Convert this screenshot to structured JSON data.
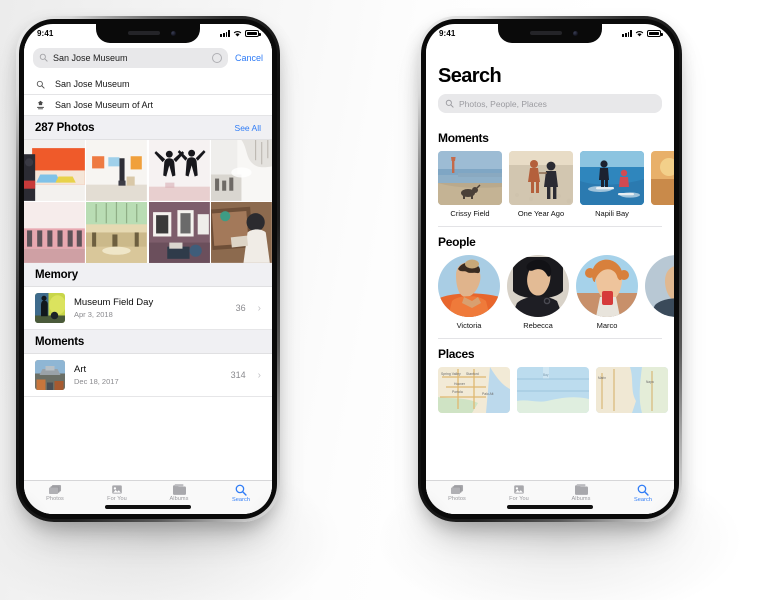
{
  "left_phone": {
    "status": {
      "time": "9:41",
      "signal_icon": "cellular-bars-icon",
      "wifi_icon": "wifi-icon",
      "battery_icon": "battery-icon"
    },
    "search": {
      "value": "San Jose Museum",
      "search_icon": "search-icon",
      "clear_icon": "clear-circle-icon",
      "cancel_label": "Cancel"
    },
    "suggestions": [
      {
        "label": "San Jose Museum",
        "icon": "search-icon"
      },
      {
        "label": "San Jose Museum of Art",
        "icon": "place-pin-icon"
      }
    ],
    "photos_section": {
      "title": "287 Photos",
      "action": "See All",
      "count": 287
    },
    "grid_photos": [
      {
        "alt": "orange-abstract-painting"
      },
      {
        "alt": "white-gallery-room"
      },
      {
        "alt": "ballet-dancers"
      },
      {
        "alt": "museum-atrium"
      },
      {
        "alt": "pink-columned-hall"
      },
      {
        "alt": "green-vaulted-gallery"
      },
      {
        "alt": "framed-prints-wall"
      },
      {
        "alt": "visitor-sketching"
      }
    ],
    "memory_section": {
      "header": "Memory",
      "items": [
        {
          "title": "Museum Field Day",
          "subtitle": "Apr 3, 2018",
          "count": "36",
          "chevron": "chevron-right-icon",
          "alt": "field-day-silhouette"
        }
      ]
    },
    "moments_section": {
      "header": "Moments",
      "items": [
        {
          "title": "Art",
          "subtitle": "Dec 18, 2017",
          "count": "314",
          "chevron": "chevron-right-icon",
          "alt": "city-rooftop-art"
        }
      ]
    },
    "tabs": [
      {
        "label": "Photos",
        "icon": "photos-icon",
        "active": false
      },
      {
        "label": "For You",
        "icon": "for-you-icon",
        "active": false
      },
      {
        "label": "Albums",
        "icon": "albums-icon",
        "active": false
      },
      {
        "label": "Search",
        "icon": "search-icon",
        "active": true
      }
    ]
  },
  "right_phone": {
    "status": {
      "time": "9:41",
      "signal_icon": "cellular-bars-icon",
      "wifi_icon": "wifi-icon",
      "battery_icon": "battery-icon"
    },
    "page_title": "Search",
    "search": {
      "placeholder": "Photos, People, Places",
      "search_icon": "search-icon"
    },
    "moments": {
      "header": "Moments",
      "items": [
        {
          "label": "Crissy Field",
          "alt": "beach-with-dog"
        },
        {
          "label": "One Year Ago",
          "alt": "couple-on-beach"
        },
        {
          "label": "Napili Bay",
          "alt": "surfers-in-ocean"
        },
        {
          "label": "",
          "alt": "partial-next-card"
        }
      ]
    },
    "people": {
      "header": "People",
      "items": [
        {
          "label": "Victoria",
          "alt": "woman-orange-top"
        },
        {
          "label": "Rebecca",
          "alt": "woman-dark-hair"
        },
        {
          "label": "Marco",
          "alt": "man-curly-hair"
        },
        {
          "label": "",
          "alt": "partial-next-avatar"
        }
      ]
    },
    "places": {
      "header": "Places",
      "items": [
        {
          "alt": "map-bay-area-land"
        },
        {
          "alt": "map-coastal-water"
        },
        {
          "alt": "map-shoreline"
        },
        {
          "alt": "map-partial"
        }
      ]
    },
    "tabs": [
      {
        "label": "Photos",
        "icon": "photos-icon",
        "active": false
      },
      {
        "label": "For You",
        "icon": "for-you-icon",
        "active": false
      },
      {
        "label": "Albums",
        "icon": "albums-icon",
        "active": false
      },
      {
        "label": "Search",
        "icon": "search-icon",
        "active": true
      }
    ]
  },
  "theme": {
    "accent": "#2f7cf6",
    "section_bg": "#f0f0f3",
    "field_bg": "#e8e8ea",
    "secondary_text": "#8a8a8e"
  }
}
